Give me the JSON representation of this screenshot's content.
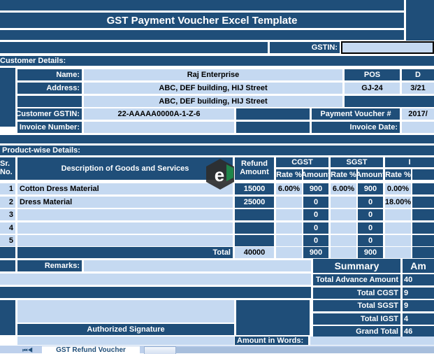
{
  "document": {
    "title": "GST Payment Voucher Excel Template",
    "gstin_label": "GSTIN:",
    "gstin_value": ""
  },
  "customer_details": {
    "section_label": "Customer Details:",
    "name_label": "Name:",
    "name_value": "Raj Enterprise",
    "address_label": "Address:",
    "address_line1": "ABC, DEF building, HIJ Street",
    "address_line2": "ABC, DEF building, HIJ Street",
    "customer_gstin_label": "Customer GSTIN:",
    "customer_gstin_value": "22-AAAAA0000A-1-Z-6",
    "invoice_number_label": "Invoice Number:",
    "invoice_number_value": "",
    "pos_label": "POS",
    "pos_value": "GJ-24",
    "date_label": "D",
    "date_value": "3/21",
    "payment_voucher_label": "Payment Voucher #",
    "payment_voucher_value": "2017/",
    "invoice_date_label": "Invoice Date:",
    "invoice_date_value": ""
  },
  "product_section": {
    "section_label": "Product-wise Details:",
    "headers": {
      "sr_no_line1": "Sr.",
      "sr_no_line2": "No.",
      "description": "Description of Goods and Services",
      "refund_line1": "Refund",
      "refund_line2": "Amount",
      "cgst": "CGST",
      "sgst": "SGST",
      "igst": "I",
      "rate": "Rate %",
      "amount": "Amount",
      "igst_rate": "Rate %"
    },
    "rows": [
      {
        "sr": "1",
        "description": "Cotton Dress Material",
        "refund": "15000",
        "cgst_rate": "6.00%",
        "cgst_amount": "900",
        "sgst_rate": "6.00%",
        "sgst_amount": "900",
        "igst_rate": "0.00%"
      },
      {
        "sr": "2",
        "description": "Dress Material",
        "refund": "25000",
        "cgst_rate": "",
        "cgst_amount": "0",
        "sgst_rate": "",
        "sgst_amount": "0",
        "igst_rate": "18.00%"
      },
      {
        "sr": "3",
        "description": "",
        "refund": "",
        "cgst_rate": "",
        "cgst_amount": "0",
        "sgst_rate": "",
        "sgst_amount": "0",
        "igst_rate": ""
      },
      {
        "sr": "4",
        "description": "",
        "refund": "",
        "cgst_rate": "",
        "cgst_amount": "0",
        "sgst_rate": "",
        "sgst_amount": "0",
        "igst_rate": ""
      },
      {
        "sr": "5",
        "description": "",
        "refund": "",
        "cgst_rate": "",
        "cgst_amount": "0",
        "sgst_rate": "",
        "sgst_amount": "0",
        "igst_rate": ""
      }
    ],
    "total": {
      "label": "Total",
      "refund": "40000",
      "cgst_rate": "",
      "cgst_amount": "900",
      "sgst_rate": "",
      "sgst_amount": "900",
      "igst_rate": ""
    }
  },
  "footer": {
    "remarks_label": "Remarks:",
    "remarks_value": "",
    "authorized_signature_label": "Authorized Signature",
    "amount_in_words_label": "Amount in Words:",
    "amount_in_words_value": ""
  },
  "summary": {
    "title": "Summary",
    "amount_header": "Am",
    "rows": [
      {
        "label": "Total Advance Amount",
        "value": "40"
      },
      {
        "label": "Total CGST",
        "value": "9"
      },
      {
        "label": "Total SGST",
        "value": "9"
      },
      {
        "label": "Total IGST",
        "value": "4"
      },
      {
        "label": "Grand Total",
        "value": "46"
      }
    ]
  },
  "tabs": {
    "nav_glyphs": "⏮ ◀",
    "active_sheet": "GST Refund Voucher"
  },
  "colors": {
    "dark_blue": "#1F4E79",
    "light_blue": "#C5D9F1",
    "white": "#FFFFFF",
    "tab_strip": "#BDD0EC"
  }
}
